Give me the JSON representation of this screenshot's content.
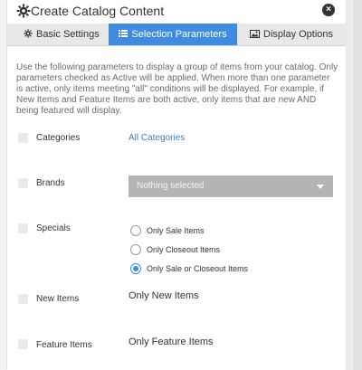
{
  "dialog": {
    "title": "Create Catalog Content",
    "close_symbol": "×"
  },
  "tabs": [
    {
      "label": "Basic Settings",
      "icon": "gear-icon"
    },
    {
      "label": "Selection Parameters",
      "icon": "list-icon",
      "active": true
    },
    {
      "label": "Display Options",
      "icon": "image-icon"
    }
  ],
  "intro_text": "Use the following parameters to display a group of items from your catalog. Only parameters checked as Active will be applied. When more than one parameter is active, only items meeting \"all\" conditions will be displayed. For example, if New Items and Feature Items are both active, only items that are new AND being featured will display.",
  "parameters": {
    "categories": {
      "label": "Categories",
      "link": "All Categories"
    },
    "brands": {
      "label": "Brands",
      "select_value": "Nothing selected"
    },
    "specials": {
      "label": "Specials",
      "options": [
        {
          "label": "Only Sale Items",
          "checked": false
        },
        {
          "label": "Only Closeout Items",
          "checked": false
        },
        {
          "label": "Only Sale or Closeout Items",
          "checked": true
        }
      ]
    },
    "new_items": {
      "label": "New Items",
      "value": "Only New Items"
    },
    "feature_items": {
      "label": "Feature Items",
      "value": "Only Feature Items"
    }
  },
  "colors": {
    "accent": "#3f8be0",
    "link": "#3c7fc5",
    "select_bg": "#b4b4b4"
  }
}
